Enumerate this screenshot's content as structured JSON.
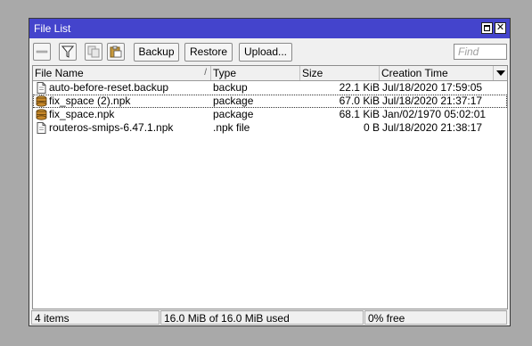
{
  "window": {
    "title": "File List"
  },
  "toolbar": {
    "backup_label": "Backup",
    "restore_label": "Restore",
    "upload_label": "Upload...",
    "find_placeholder": "Find"
  },
  "table": {
    "columns": [
      {
        "label": "File Name",
        "sort_indicator": "/"
      },
      {
        "label": "Type"
      },
      {
        "label": "Size"
      },
      {
        "label": "Creation Time"
      }
    ],
    "rows": [
      {
        "name": "auto-before-reset.backup",
        "type": "backup",
        "size": "22.1 KiB",
        "created": "Jul/18/2020 17:59:05",
        "icon": "document-icon",
        "selected": false
      },
      {
        "name": "fix_space (2).npk",
        "type": "package",
        "size": "67.0 KiB",
        "created": "Jul/18/2020 21:37:17",
        "icon": "package-icon",
        "selected": true
      },
      {
        "name": "fix_space.npk",
        "type": "package",
        "size": "68.1 KiB",
        "created": "Jan/02/1970 05:02:01",
        "icon": "package-icon",
        "selected": false
      },
      {
        "name": "routeros-smips-6.47.1.npk",
        "type": ".npk file",
        "size": "0 B",
        "created": "Jul/18/2020 21:38:17",
        "icon": "document-icon",
        "selected": false
      }
    ]
  },
  "status": {
    "items": "4 items",
    "usage": "16.0 MiB of 16.0 MiB used",
    "free": "0% free"
  },
  "colors": {
    "titlebar": "#4444cc",
    "window_bg": "#f0f0f0",
    "desktop_bg": "#a9a9a9"
  }
}
